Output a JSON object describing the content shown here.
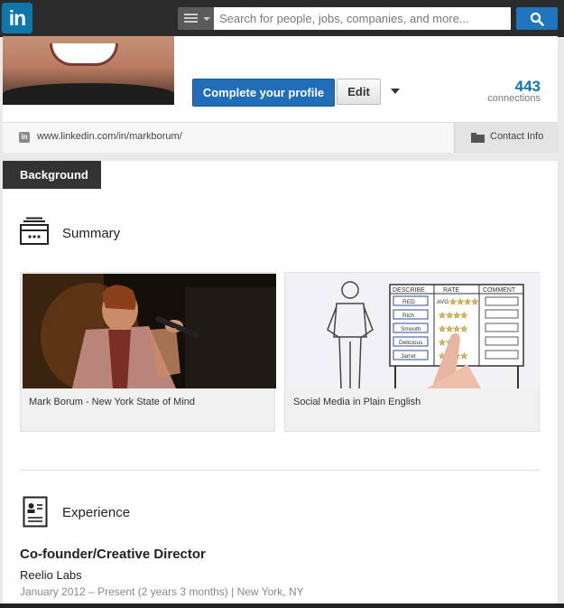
{
  "header": {
    "logo_text": "in",
    "search_placeholder": "Search for people, jobs, companies, and more...",
    "search_icon": "search-icon",
    "menu_icon": "menu-icon"
  },
  "profile": {
    "complete_label": "Complete your profile",
    "edit_label": "Edit",
    "connections_count": "443",
    "connections_label": "connections",
    "public_url": "www.linkedin.com/in/markborum/",
    "contact_label": "Contact Info"
  },
  "background": {
    "tab_label": "Background",
    "summary": {
      "title": "Summary",
      "media": [
        {
          "caption": "Mark Borum - New York State of Mind"
        },
        {
          "caption": "Social Media in Plain English",
          "whiteboard": {
            "headers": [
              "DESCRIBE",
              "RATE",
              "COMMENT"
            ],
            "rows": [
              "RED",
              "Rich",
              "Smooth",
              "Delicious",
              "Jarret"
            ],
            "avg_label": "AVG"
          }
        }
      ]
    },
    "experience": {
      "title": "Experience",
      "position": "Co-founder/Creative Director",
      "company": "Reelio Labs",
      "dates": "January 2012 – Present (2 years 3 months)  |  New York, NY"
    }
  },
  "colors": {
    "brand": "#0e76a8",
    "primary_button": "#1f6eb7",
    "topbar": "#2b2b2b"
  }
}
